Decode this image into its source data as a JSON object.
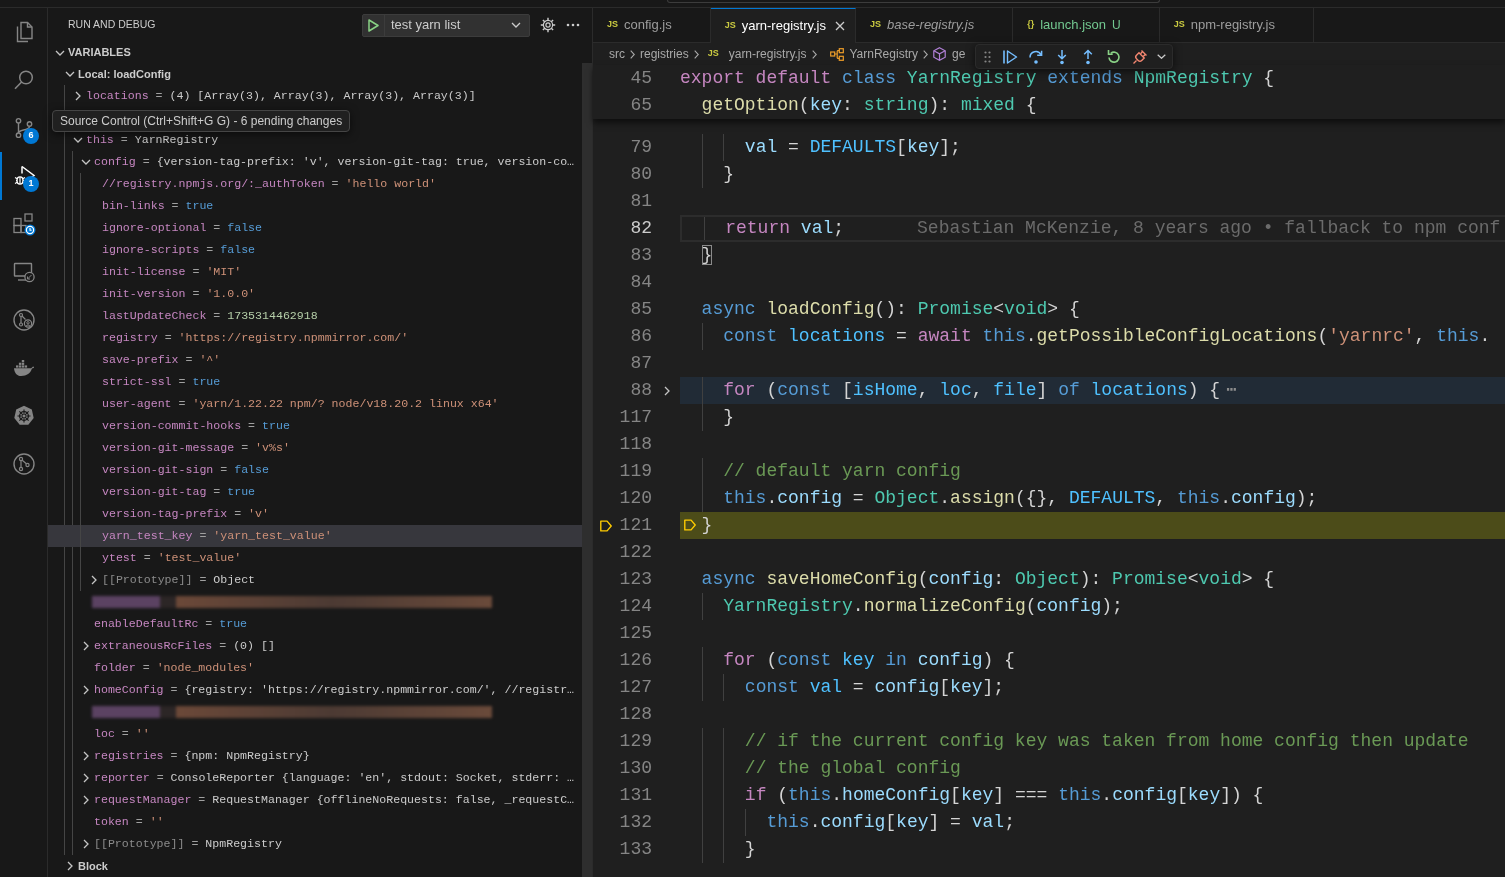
{
  "activity_bar": [
    {
      "kind": "explorer",
      "selected": false
    },
    {
      "kind": "search",
      "selected": false
    },
    {
      "kind": "source-control",
      "selected": false,
      "badge": "6",
      "tooltip": "Source Control (Ctrl+Shift+G G) - 6 pending changes"
    },
    {
      "kind": "run-debug",
      "selected": true,
      "badge": "1"
    },
    {
      "kind": "extensions",
      "selected": false
    },
    {
      "kind": "remote-explorer",
      "selected": false
    },
    {
      "kind": "git-inspect",
      "selected": false
    },
    {
      "kind": "docker",
      "selected": false
    },
    {
      "kind": "kubernetes",
      "selected": false
    },
    {
      "kind": "git-graph",
      "selected": false
    }
  ],
  "sidebar": {
    "title": "RUN AND DEBUG",
    "launch_config": "test yarn list",
    "variables": {
      "title": "VARIABLES",
      "expanded": true,
      "scopes": [
        {
          "name": "Local: loadConfig",
          "expanded": true,
          "selected": false,
          "children": [
            {
              "kind": "object",
              "name": "locations",
              "eq": "=",
              "value": "(4) [Array(3), Array(3), Array(3), Array(3)]",
              "expanded": false,
              "selected": false
            },
            {
              "kind": "object",
              "name": "this",
              "eq": "=",
              "value": "YarnRegistry",
              "expanded": true,
              "selected": false,
              "children": [
                {
                  "kind": "object",
                  "name": "config",
                  "eq": "=",
                  "value": "{version-tag-prefix: 'v', version-git-tag: true, version-co…",
                  "expanded": true,
                  "selected": false,
                  "children": [
                    {
                      "kind": "string",
                      "name": "//registry.npmjs.org/:_authToken",
                      "eq": "=",
                      "value": "'hello world'",
                      "selected": false
                    },
                    {
                      "kind": "boolean",
                      "name": "bin-links",
                      "eq": "=",
                      "value": "true",
                      "selected": false
                    },
                    {
                      "kind": "boolean",
                      "name": "ignore-optional",
                      "eq": "=",
                      "value": "false",
                      "selected": false
                    },
                    {
                      "kind": "boolean",
                      "name": "ignore-scripts",
                      "eq": "=",
                      "value": "false",
                      "selected": false
                    },
                    {
                      "kind": "string",
                      "name": "init-license",
                      "eq": "=",
                      "value": "'MIT'",
                      "selected": false
                    },
                    {
                      "kind": "string",
                      "name": "init-version",
                      "eq": "=",
                      "value": "'1.0.0'",
                      "selected": false
                    },
                    {
                      "kind": "number",
                      "name": "lastUpdateCheck",
                      "eq": "=",
                      "value": "1735314462918",
                      "selected": false
                    },
                    {
                      "kind": "string",
                      "name": "registry",
                      "eq": "=",
                      "value": "'https://registry.npmmirror.com/'",
                      "selected": false
                    },
                    {
                      "kind": "string",
                      "name": "save-prefix",
                      "eq": "=",
                      "value": "'^'",
                      "selected": false
                    },
                    {
                      "kind": "boolean",
                      "name": "strict-ssl",
                      "eq": "=",
                      "value": "true",
                      "selected": false
                    },
                    {
                      "kind": "string",
                      "name": "user-agent",
                      "eq": "=",
                      "value": "'yarn/1.22.22 npm/? node/v18.20.2 linux x64'",
                      "selected": false
                    },
                    {
                      "kind": "boolean",
                      "name": "version-commit-hooks",
                      "eq": "=",
                      "value": "true",
                      "selected": false
                    },
                    {
                      "kind": "string",
                      "name": "version-git-message",
                      "eq": "=",
                      "value": "'v%s'",
                      "selected": false
                    },
                    {
                      "kind": "boolean",
                      "name": "version-git-sign",
                      "eq": "=",
                      "value": "false",
                      "selected": false
                    },
                    {
                      "kind": "boolean",
                      "name": "version-git-tag",
                      "eq": "=",
                      "value": "true",
                      "selected": false
                    },
                    {
                      "kind": "string",
                      "name": "version-tag-prefix",
                      "eq": "=",
                      "value": "'v'",
                      "selected": false
                    },
                    {
                      "kind": "string",
                      "name": "yarn_test_key",
                      "eq": "=",
                      "value": "'yarn_test_value'",
                      "selected": true
                    },
                    {
                      "kind": "string",
                      "name": "ytest",
                      "eq": "=",
                      "value": "'test_value'",
                      "selected": false
                    },
                    {
                      "kind": "internal",
                      "name": "[[Prototype]]",
                      "eq": "=",
                      "value": "Object",
                      "expanded": false,
                      "selected": false
                    }
                  ]
                },
                {
                  "kind": "redacted"
                },
                {
                  "kind": "boolean",
                  "name": "enableDefaultRc",
                  "eq": "=",
                  "value": "true",
                  "selected": false
                },
                {
                  "kind": "object",
                  "name": "extraneousRcFiles",
                  "eq": "=",
                  "value": "(0) []",
                  "expanded": false,
                  "selected": false
                },
                {
                  "kind": "string",
                  "name": "folder",
                  "eq": "=",
                  "value": "'node_modules'",
                  "selected": false
                },
                {
                  "kind": "object",
                  "name": "homeConfig",
                  "eq": "=",
                  "value": "{registry: 'https://registry.npmmirror.com/', //registr…",
                  "expanded": false,
                  "selected": false
                },
                {
                  "kind": "redacted"
                },
                {
                  "kind": "string",
                  "name": "loc",
                  "eq": "=",
                  "value": "''",
                  "selected": false
                },
                {
                  "kind": "object",
                  "name": "registries",
                  "eq": "=",
                  "value": "{npm: NpmRegistry}",
                  "expanded": false,
                  "selected": false
                },
                {
                  "kind": "object",
                  "name": "reporter",
                  "eq": "=",
                  "value": "ConsoleReporter {language: 'en', stdout: Socket, stderr: …",
                  "expanded": false,
                  "selected": false
                },
                {
                  "kind": "object",
                  "name": "requestManager",
                  "eq": "=",
                  "value": "RequestManager {offlineNoRequests: false, _requestC…",
                  "expanded": false,
                  "selected": false
                },
                {
                  "kind": "string",
                  "name": "token",
                  "eq": "=",
                  "value": "''",
                  "selected": false
                },
                {
                  "kind": "internal",
                  "name": "[[Prototype]]",
                  "eq": "=",
                  "value": "NpmRegistry",
                  "expanded": false,
                  "selected": false
                }
              ]
            }
          ]
        },
        {
          "name": "Block",
          "expanded": false,
          "selected": false
        }
      ]
    }
  },
  "editor": {
    "tabs": [
      {
        "icon": "JS",
        "label": "config.js",
        "selected": false,
        "preview": false
      },
      {
        "icon": "JS",
        "label": "yarn-registry.js",
        "selected": true,
        "preview": false
      },
      {
        "icon": "JS",
        "label": "base-registry.js",
        "selected": false,
        "preview": true
      },
      {
        "icon": "{}",
        "label": "launch.json",
        "decoration": "U",
        "selected": false,
        "preview": false
      },
      {
        "icon": "JS",
        "label": "npm-registry.js",
        "selected": false,
        "preview": false
      }
    ],
    "breadcrumbs": [
      {
        "kind": "folder",
        "label": "src"
      },
      {
        "kind": "folder",
        "label": "registries"
      },
      {
        "kind": "file",
        "icon": "JS",
        "label": "yarn-registry.js"
      },
      {
        "kind": "class",
        "label": "YarnRegistry"
      },
      {
        "kind": "method",
        "label": "ge"
      }
    ],
    "debug_toolbar": [
      {
        "kind": "continue"
      },
      {
        "kind": "step-over"
      },
      {
        "kind": "step-into"
      },
      {
        "kind": "step-out"
      },
      {
        "kind": "restart"
      },
      {
        "kind": "disconnect"
      }
    ],
    "sticky_lines": [
      {
        "number": "45",
        "kind": "code",
        "tokens": [
          {
            "text": "export default",
            "kind": "control"
          },
          {
            "text": " class",
            "kind": "keyword"
          },
          {
            "text": " YarnRegistry",
            "kind": "type"
          },
          {
            "text": " extends",
            "kind": "keyword"
          },
          {
            "text": " NpmRegistry",
            "kind": "type"
          },
          {
            "text": " {",
            "kind": "plain"
          }
        ]
      },
      {
        "number": "65",
        "kind": "code",
        "tokens": [
          {
            "text": "  getOption",
            "kind": "function"
          },
          {
            "text": "(",
            "kind": "plain"
          },
          {
            "text": "key",
            "kind": "variable"
          },
          {
            "text": ": ",
            "kind": "plain"
          },
          {
            "text": "string",
            "kind": "type"
          },
          {
            "text": "): ",
            "kind": "plain"
          },
          {
            "text": "mixed",
            "kind": "type"
          },
          {
            "text": " {",
            "kind": "plain"
          }
        ]
      }
    ],
    "lines": [
      {
        "number": "79",
        "kind": "code",
        "tokens": [
          {
            "text": "      val",
            "kind": "variable"
          },
          {
            "text": " = ",
            "kind": "plain"
          },
          {
            "text": "DEFAULTS",
            "kind": "constant"
          },
          {
            "text": "[",
            "kind": "plain"
          },
          {
            "text": "key",
            "kind": "variable"
          },
          {
            "text": "];",
            "kind": "plain"
          }
        ]
      },
      {
        "number": "80",
        "kind": "code",
        "tokens": [
          {
            "text": "    }",
            "kind": "plain"
          }
        ]
      },
      {
        "number": "81",
        "kind": "code"
      },
      {
        "number": "82",
        "kind": "cursor",
        "tokens": [
          {
            "text": "    return",
            "kind": "control"
          },
          {
            "text": " val",
            "kind": "variable"
          },
          {
            "text": ";",
            "kind": "plain"
          }
        ],
        "blame": "Sebastian McKenzie, 8 years ago • fallback to npm conf"
      },
      {
        "number": "83",
        "kind": "code",
        "tokens": [
          {
            "text": "  }",
            "kind": "bracket-match"
          }
        ]
      },
      {
        "number": "84",
        "kind": "code"
      },
      {
        "number": "85",
        "kind": "code",
        "tokens": [
          {
            "text": "  async",
            "kind": "keyword"
          },
          {
            "text": " loadConfig",
            "kind": "function"
          },
          {
            "text": "(): ",
            "kind": "plain"
          },
          {
            "text": "Promise",
            "kind": "type"
          },
          {
            "text": "<",
            "kind": "plain"
          },
          {
            "text": "void",
            "kind": "type"
          },
          {
            "text": "> {",
            "kind": "plain"
          }
        ]
      },
      {
        "number": "86",
        "kind": "code",
        "tokens": [
          {
            "text": "    const",
            "kind": "keyword"
          },
          {
            "text": " locations",
            "kind": "constant"
          },
          {
            "text": " = ",
            "kind": "plain"
          },
          {
            "text": "await",
            "kind": "control"
          },
          {
            "text": " this",
            "kind": "keyword"
          },
          {
            "text": ".",
            "kind": "plain"
          },
          {
            "text": "getPossibleConfigLocations",
            "kind": "function"
          },
          {
            "text": "(",
            "kind": "plain"
          },
          {
            "text": "'yarnrc'",
            "kind": "string"
          },
          {
            "text": ", ",
            "kind": "plain"
          },
          {
            "text": "this",
            "kind": "keyword"
          },
          {
            "text": ".",
            "kind": "plain"
          }
        ]
      },
      {
        "number": "87",
        "kind": "code"
      },
      {
        "number": "88",
        "kind": "folded",
        "tokens": [
          {
            "text": "    for",
            "kind": "control"
          },
          {
            "text": " (",
            "kind": "plain"
          },
          {
            "text": "const",
            "kind": "keyword"
          },
          {
            "text": " [",
            "kind": "plain"
          },
          {
            "text": "isHome",
            "kind": "constant"
          },
          {
            "text": ", ",
            "kind": "plain"
          },
          {
            "text": "loc",
            "kind": "constant"
          },
          {
            "text": ", ",
            "kind": "plain"
          },
          {
            "text": "file",
            "kind": "constant"
          },
          {
            "text": "] ",
            "kind": "plain"
          },
          {
            "text": "of",
            "kind": "keyword"
          },
          {
            "text": " locations",
            "kind": "constant"
          },
          {
            "text": ") {",
            "kind": "plain"
          }
        ],
        "fold_placeholder": "⋯"
      },
      {
        "number": "117",
        "kind": "code",
        "tokens": [
          {
            "text": "    }",
            "kind": "plain"
          }
        ]
      },
      {
        "number": "118",
        "kind": "code"
      },
      {
        "number": "119",
        "kind": "code",
        "tokens": [
          {
            "text": "    // default yarn config",
            "kind": "comment"
          }
        ]
      },
      {
        "number": "120",
        "kind": "code",
        "tokens": [
          {
            "text": "    this",
            "kind": "keyword"
          },
          {
            "text": ".",
            "kind": "plain"
          },
          {
            "text": "config",
            "kind": "variable"
          },
          {
            "text": " = ",
            "kind": "plain"
          },
          {
            "text": "Object",
            "kind": "type"
          },
          {
            "text": ".",
            "kind": "plain"
          },
          {
            "text": "assign",
            "kind": "function"
          },
          {
            "text": "({}, ",
            "kind": "plain"
          },
          {
            "text": "DEFAULTS",
            "kind": "constant"
          },
          {
            "text": ", ",
            "kind": "plain"
          },
          {
            "text": "this",
            "kind": "keyword"
          },
          {
            "text": ".",
            "kind": "plain"
          },
          {
            "text": "config",
            "kind": "variable"
          },
          {
            "text": ");",
            "kind": "plain"
          }
        ]
      },
      {
        "number": "121",
        "kind": "paused",
        "tokens": [
          {
            "text": "  }",
            "kind": "plain"
          }
        ]
      },
      {
        "number": "122",
        "kind": "code"
      },
      {
        "number": "123",
        "kind": "code",
        "tokens": [
          {
            "text": "  async",
            "kind": "keyword"
          },
          {
            "text": " saveHomeConfig",
            "kind": "function"
          },
          {
            "text": "(",
            "kind": "plain"
          },
          {
            "text": "config",
            "kind": "variable"
          },
          {
            "text": ": ",
            "kind": "plain"
          },
          {
            "text": "Object",
            "kind": "type"
          },
          {
            "text": "): ",
            "kind": "plain"
          },
          {
            "text": "Promise",
            "kind": "type"
          },
          {
            "text": "<",
            "kind": "plain"
          },
          {
            "text": "void",
            "kind": "type"
          },
          {
            "text": "> {",
            "kind": "plain"
          }
        ]
      },
      {
        "number": "124",
        "kind": "code",
        "tokens": [
          {
            "text": "    YarnRegistry",
            "kind": "type"
          },
          {
            "text": ".",
            "kind": "plain"
          },
          {
            "text": "normalizeConfig",
            "kind": "function"
          },
          {
            "text": "(",
            "kind": "plain"
          },
          {
            "text": "config",
            "kind": "variable"
          },
          {
            "text": ");",
            "kind": "plain"
          }
        ]
      },
      {
        "number": "125",
        "kind": "code"
      },
      {
        "number": "126",
        "kind": "code",
        "tokens": [
          {
            "text": "    for",
            "kind": "control"
          },
          {
            "text": " (",
            "kind": "plain"
          },
          {
            "text": "const",
            "kind": "keyword"
          },
          {
            "text": " key",
            "kind": "constant"
          },
          {
            "text": " in",
            "kind": "keyword"
          },
          {
            "text": " config",
            "kind": "variable"
          },
          {
            "text": ") {",
            "kind": "plain"
          }
        ]
      },
      {
        "number": "127",
        "kind": "code",
        "tokens": [
          {
            "text": "      const",
            "kind": "keyword"
          },
          {
            "text": " val",
            "kind": "constant"
          },
          {
            "text": " = ",
            "kind": "plain"
          },
          {
            "text": "config",
            "kind": "variable"
          },
          {
            "text": "[",
            "kind": "plain"
          },
          {
            "text": "key",
            "kind": "variable"
          },
          {
            "text": "];",
            "kind": "plain"
          }
        ]
      },
      {
        "number": "128",
        "kind": "code"
      },
      {
        "number": "129",
        "kind": "code",
        "tokens": [
          {
            "text": "      // if the current config key was taken from home config then update",
            "kind": "comment"
          }
        ]
      },
      {
        "number": "130",
        "kind": "code",
        "tokens": [
          {
            "text": "      // the global config",
            "kind": "comment"
          }
        ]
      },
      {
        "number": "131",
        "kind": "code",
        "tokens": [
          {
            "text": "      if",
            "kind": "control"
          },
          {
            "text": " (",
            "kind": "plain"
          },
          {
            "text": "this",
            "kind": "keyword"
          },
          {
            "text": ".",
            "kind": "plain"
          },
          {
            "text": "homeConfig",
            "kind": "variable"
          },
          {
            "text": "[",
            "kind": "plain"
          },
          {
            "text": "key",
            "kind": "variable"
          },
          {
            "text": "] === ",
            "kind": "plain"
          },
          {
            "text": "this",
            "kind": "keyword"
          },
          {
            "text": ".",
            "kind": "plain"
          },
          {
            "text": "config",
            "kind": "variable"
          },
          {
            "text": "[",
            "kind": "plain"
          },
          {
            "text": "key",
            "kind": "variable"
          },
          {
            "text": "]) {",
            "kind": "plain"
          }
        ]
      },
      {
        "number": "132",
        "kind": "code",
        "tokens": [
          {
            "text": "        this",
            "kind": "keyword"
          },
          {
            "text": ".",
            "kind": "plain"
          },
          {
            "text": "config",
            "kind": "variable"
          },
          {
            "text": "[",
            "kind": "plain"
          },
          {
            "text": "key",
            "kind": "variable"
          },
          {
            "text": "] = ",
            "kind": "plain"
          },
          {
            "text": "val",
            "kind": "variable"
          },
          {
            "text": ";",
            "kind": "plain"
          }
        ]
      },
      {
        "number": "133",
        "kind": "code",
        "tokens": [
          {
            "text": "      }",
            "kind": "plain"
          }
        ]
      }
    ]
  }
}
